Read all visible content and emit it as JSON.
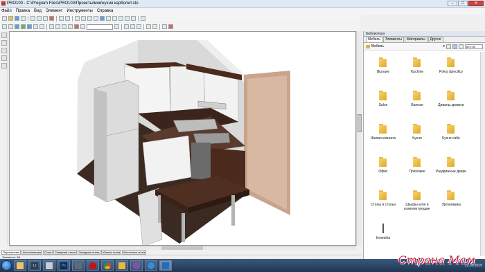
{
  "window": {
    "title": "PRO100 - C:\\Program Files\\PRO100\\Проекты\\мои\\кухня карболит.sto"
  },
  "menu": [
    "Файл",
    "Правка",
    "Вид",
    "Элемент",
    "Инструменты",
    "Справка"
  ],
  "view_tabs": [
    "Перспектива",
    "Аксонометрия",
    "План",
    "Северная стена",
    "Западная стена",
    "Южная стена",
    "Восточная стена"
  ],
  "status": {
    "text": "Элементы: 58"
  },
  "library": {
    "title": "Библиотека",
    "tabs": [
      "Мебель",
      "Элементы",
      "Материалы",
      "Другое"
    ],
    "path": "Мебель",
    "size": "80 x 80",
    "items": [
      {
        "label": "Biurowe",
        "icon": "folder-icon"
      },
      {
        "label": "Kuchnie",
        "icon": "folder-icon"
      },
      {
        "label": "Pokoj dziecilicy",
        "icon": "folder-icon"
      },
      {
        "label": "Salon",
        "icon": "folder-icon"
      },
      {
        "label": "Ванная",
        "icon": "folder-icon"
      },
      {
        "label": "Диваны,кровати",
        "icon": "folder-icon"
      },
      {
        "label": "Жилая комната",
        "icon": "folder-icon"
      },
      {
        "label": "Кухня",
        "icon": "folder-icon"
      },
      {
        "label": "Кухня сабе",
        "icon": "folder-icon"
      },
      {
        "label": "Офис",
        "icon": "folder-icon"
      },
      {
        "label": "Прихожие",
        "icon": "folder-icon"
      },
      {
        "label": "Раздвижные двери",
        "icon": "folder-icon"
      },
      {
        "label": "Столы и стулья",
        "icon": "folder-icon"
      },
      {
        "label": "Шкафы купе и комплектующие",
        "icon": "folder-icon"
      },
      {
        "label": "Эргономика",
        "icon": "folder-icon"
      },
      {
        "label": "krowatka",
        "icon": "item-icon"
      }
    ]
  },
  "taskbar": {
    "apps": [
      "windows-explorer",
      "lightroom",
      "file-manager",
      "photoshop",
      "monitor",
      "opera",
      "chrome",
      "folder",
      "viber",
      "internet-explorer",
      "pro100"
    ],
    "lightroom_label": "Lr",
    "photoshop_label": "Ps",
    "date": "22.09.2015"
  },
  "watermark": "Страна Мам"
}
